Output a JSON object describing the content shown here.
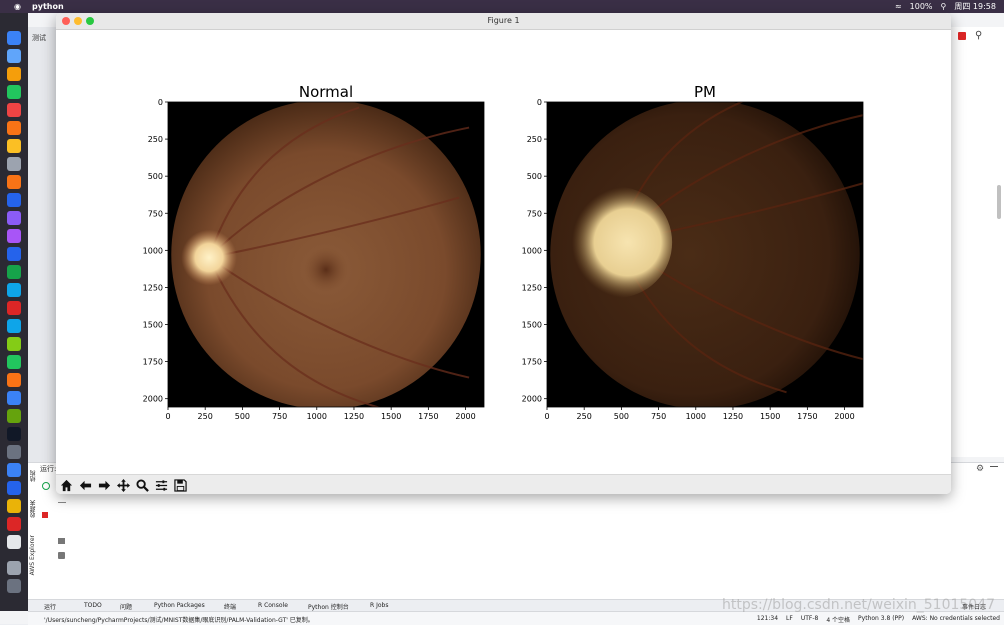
{
  "menubar": {
    "app_name": "python",
    "clock": "周四 19:58",
    "battery": "100%"
  },
  "ide": {
    "tab_label": "测试",
    "run_label": "运行:",
    "bottom_tabs": [
      "运行",
      "TODO",
      "问题",
      "Python Packages",
      "终端",
      "R Console",
      "Python 控制台",
      "R Jobs",
      "事件日志"
    ],
    "status_message": "'/Users/suncheng/PycharmProjects/测试/MNIST数据集/眼底识别/PALM-Validation-GT' 已复制。",
    "status_right": [
      "121:34",
      "LF",
      "UTF-8",
      "4 个空格",
      "Python 3.8 (PP)",
      "AWS: No credentials selected"
    ],
    "side_labels": [
      "AWS Explorer",
      "收藏夹",
      "结构"
    ]
  },
  "figure": {
    "window_title": "Figure 1",
    "toolbar": [
      {
        "name": "home-icon",
        "label": "home"
      },
      {
        "name": "back-icon",
        "label": "back"
      },
      {
        "name": "forward-icon",
        "label": "forward"
      },
      {
        "name": "pan-icon",
        "label": "pan"
      },
      {
        "name": "zoom-icon",
        "label": "zoom"
      },
      {
        "name": "configure-subplots-icon",
        "label": "configure"
      },
      {
        "name": "save-icon",
        "label": "save"
      }
    ]
  },
  "chart_data": [
    {
      "type": "image",
      "title": "Normal",
      "xticks": [
        0,
        250,
        500,
        750,
        1000,
        1250,
        1500,
        1750,
        2000
      ],
      "yticks": [
        0,
        250,
        500,
        750,
        1000,
        1250,
        1500,
        1750,
        2000
      ],
      "xlim": [
        0,
        2124
      ],
      "ylim": [
        2056,
        0
      ],
      "colors": {
        "background": "#000000",
        "fundus": "#8a5a38",
        "disc": "#f2d49a"
      }
    },
    {
      "type": "image",
      "title": "PM",
      "xticks": [
        0,
        250,
        500,
        750,
        1000,
        1250,
        1500,
        1750,
        2000
      ],
      "yticks": [
        0,
        250,
        500,
        750,
        1000,
        1250,
        1500,
        1750,
        2000
      ],
      "xlim": [
        0,
        2124
      ],
      "ylim": [
        2056,
        0
      ],
      "colors": {
        "background": "#000000",
        "fundus": "#4a2c16",
        "disc": "#e8cf92"
      }
    }
  ],
  "watermark": "https://blog.csdn.net/weixin_51015047"
}
